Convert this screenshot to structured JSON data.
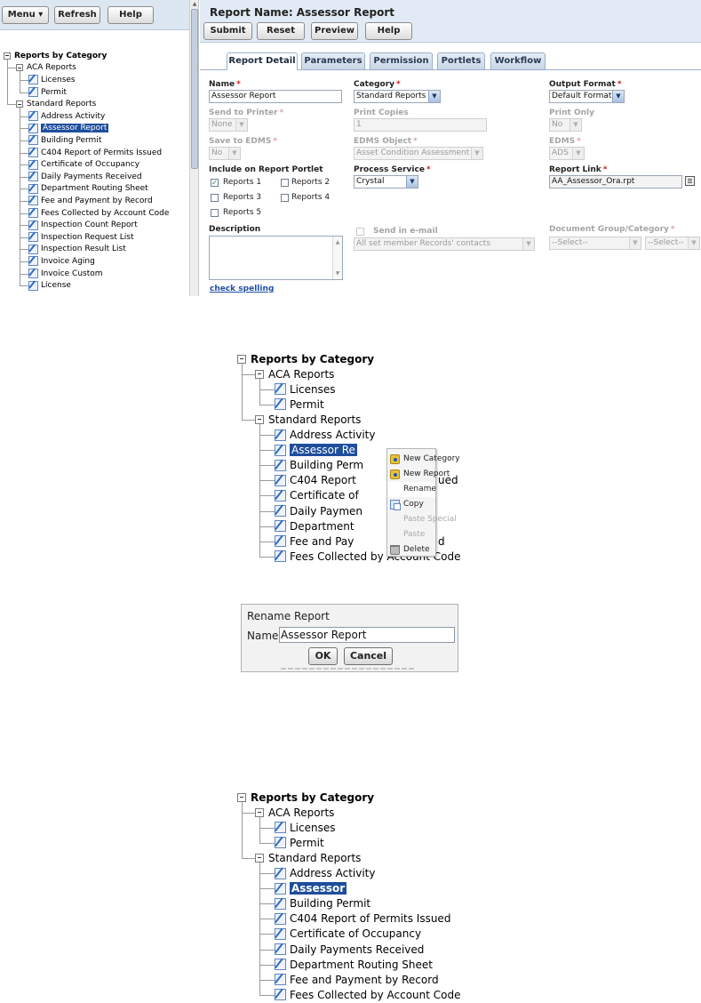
{
  "left_toolbar": {
    "menu_label": "Menu",
    "menu_icon": "chevron-down-icon",
    "refresh_label": "Refresh",
    "help_label": "Help"
  },
  "tree": {
    "root": "Reports by Category",
    "groups": [
      {
        "label": "ACA Reports",
        "items": [
          "Licenses",
          "Permit"
        ]
      },
      {
        "label": "Standard Reports",
        "items": [
          "Address Activity",
          "Assessor Report",
          "Building Permit",
          "C404 Report of Permits Issued",
          "Certificate of Occupancy",
          "Daily Payments Received",
          "Department Routing Sheet",
          "Fee and Payment by Record",
          "Fees Collected by Account Code",
          "Inspection Count Report",
          "Inspection Request List",
          "Inspection Result List",
          "Invoice Aging",
          "Invoice Custom",
          "License"
        ]
      }
    ],
    "selected": "Assessor Report",
    "highlight_color": "#1f4e9c"
  },
  "report": {
    "title": "Report Name: Assessor Report",
    "buttons": {
      "submit": "Submit",
      "reset": "Reset",
      "preview": "Preview",
      "help": "Help"
    },
    "tabs": [
      "Report Detail",
      "Parameters",
      "Permission",
      "Portlets",
      "Workflow"
    ],
    "active_tab": "Report Detail",
    "required_mark": "*",
    "fields": {
      "name": {
        "label": "Name",
        "value": "Assessor Report"
      },
      "category": {
        "label": "Category",
        "value": "Standard Reports"
      },
      "output_format": {
        "label": "Output Format",
        "value": "Default Format"
      },
      "send_to_printer": {
        "label": "Send to Printer",
        "value": "None"
      },
      "print_copies": {
        "label": "Print Copies",
        "value": "1"
      },
      "print_only": {
        "label": "Print Only",
        "value": "No"
      },
      "save_to_edms": {
        "label": "Save to EDMS",
        "value": "No"
      },
      "edms_object": {
        "label": "EDMS Object",
        "value": "Asset Condition Assessment"
      },
      "edms": {
        "label": "EDMS",
        "value": "ADS"
      },
      "include_portlet": {
        "label": "Include on Report Portlet",
        "options": [
          "Reports 1",
          "Reports 2",
          "Reports 3",
          "Reports 4",
          "Reports 5"
        ],
        "checked": [
          true,
          false,
          false,
          false,
          false
        ]
      },
      "process_service": {
        "label": "Process Service",
        "value": "Crystal"
      },
      "report_link": {
        "label": "Report Link",
        "value": "AA_Assessor_Ora.rpt"
      },
      "description": {
        "label": "Description",
        "value": ""
      },
      "send_in_email": {
        "label": "Send in e-mail",
        "value": "All set member Records' contacts"
      },
      "document_group": {
        "label": "Document Group/Category",
        "group_value": "--Select--",
        "category_value": "--Select--"
      }
    },
    "check_spelling": "check spelling"
  },
  "context_menu": {
    "items": [
      {
        "label": "New Category",
        "icon": "new-category-icon",
        "enabled": true
      },
      {
        "label": "New Report",
        "icon": "new-report-icon",
        "enabled": true
      },
      {
        "label": "Rename",
        "icon": "",
        "enabled": true
      },
      {
        "label": "Copy",
        "icon": "copy-icon",
        "enabled": true
      },
      {
        "label": "Paste Special",
        "icon": "",
        "enabled": false
      },
      {
        "label": "Paste",
        "icon": "",
        "enabled": false
      },
      {
        "label": "Delete",
        "icon": "trash-icon",
        "enabled": true
      }
    ],
    "hovered": "Rename"
  },
  "menu_snippet_tree": {
    "root": "Reports by Category",
    "groups": [
      {
        "label": "ACA Reports",
        "items": [
          "Licenses",
          "Permit"
        ]
      },
      {
        "label": "Standard Reports",
        "items": [
          "Address Activity",
          "Assessor Re",
          "Building Perm",
          "C404 Report",
          "Certificate of",
          "Daily Paymen",
          "Department",
          "Fee and Pay",
          "Fees Collected by Account Code"
        ]
      }
    ],
    "partial_tail": {
      "c404": "ued",
      "fee": "d"
    },
    "selected": "Assessor Re"
  },
  "rename_dialog": {
    "title": "Rename Report",
    "name_label": "Name",
    "name_value": "Assessor Report",
    "ok_label": "OK",
    "cancel_label": "Cancel"
  },
  "result_tree": {
    "root": "Reports by Category",
    "groups": [
      {
        "label": "ACA Reports",
        "items": [
          "Licenses",
          "Permit"
        ]
      },
      {
        "label": "Standard Reports",
        "items": [
          "Address Activity",
          "Assessor",
          "Building Permit",
          "C404 Report of Permits Issued",
          "Certificate of Occupancy",
          "Daily Payments Received",
          "Department Routing Sheet",
          "Fee and Payment by Record",
          "Fees Collected by Account Code"
        ]
      }
    ],
    "selected": "Assessor"
  }
}
